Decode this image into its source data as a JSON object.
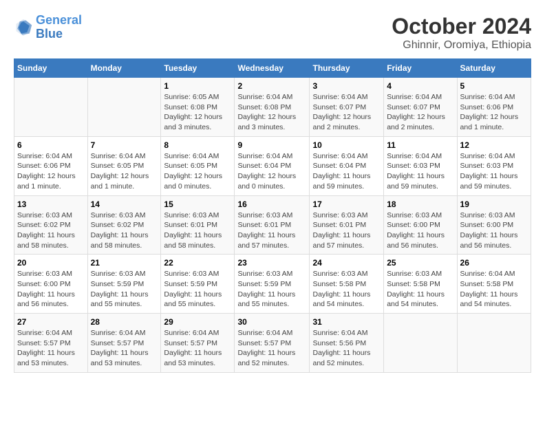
{
  "header": {
    "logo_line1": "General",
    "logo_line2": "Blue",
    "month": "October 2024",
    "location": "Ghinnir, Oromiya, Ethiopia"
  },
  "weekdays": [
    "Sunday",
    "Monday",
    "Tuesday",
    "Wednesday",
    "Thursday",
    "Friday",
    "Saturday"
  ],
  "weeks": [
    [
      {
        "day": "",
        "info": ""
      },
      {
        "day": "",
        "info": ""
      },
      {
        "day": "1",
        "info": "Sunrise: 6:05 AM\nSunset: 6:08 PM\nDaylight: 12 hours and 3 minutes."
      },
      {
        "day": "2",
        "info": "Sunrise: 6:04 AM\nSunset: 6:08 PM\nDaylight: 12 hours and 3 minutes."
      },
      {
        "day": "3",
        "info": "Sunrise: 6:04 AM\nSunset: 6:07 PM\nDaylight: 12 hours and 2 minutes."
      },
      {
        "day": "4",
        "info": "Sunrise: 6:04 AM\nSunset: 6:07 PM\nDaylight: 12 hours and 2 minutes."
      },
      {
        "day": "5",
        "info": "Sunrise: 6:04 AM\nSunset: 6:06 PM\nDaylight: 12 hours and 1 minute."
      }
    ],
    [
      {
        "day": "6",
        "info": "Sunrise: 6:04 AM\nSunset: 6:06 PM\nDaylight: 12 hours and 1 minute."
      },
      {
        "day": "7",
        "info": "Sunrise: 6:04 AM\nSunset: 6:05 PM\nDaylight: 12 hours and 1 minute."
      },
      {
        "day": "8",
        "info": "Sunrise: 6:04 AM\nSunset: 6:05 PM\nDaylight: 12 hours and 0 minutes."
      },
      {
        "day": "9",
        "info": "Sunrise: 6:04 AM\nSunset: 6:04 PM\nDaylight: 12 hours and 0 minutes."
      },
      {
        "day": "10",
        "info": "Sunrise: 6:04 AM\nSunset: 6:04 PM\nDaylight: 11 hours and 59 minutes."
      },
      {
        "day": "11",
        "info": "Sunrise: 6:04 AM\nSunset: 6:03 PM\nDaylight: 11 hours and 59 minutes."
      },
      {
        "day": "12",
        "info": "Sunrise: 6:04 AM\nSunset: 6:03 PM\nDaylight: 11 hours and 59 minutes."
      }
    ],
    [
      {
        "day": "13",
        "info": "Sunrise: 6:03 AM\nSunset: 6:02 PM\nDaylight: 11 hours and 58 minutes."
      },
      {
        "day": "14",
        "info": "Sunrise: 6:03 AM\nSunset: 6:02 PM\nDaylight: 11 hours and 58 minutes."
      },
      {
        "day": "15",
        "info": "Sunrise: 6:03 AM\nSunset: 6:01 PM\nDaylight: 11 hours and 58 minutes."
      },
      {
        "day": "16",
        "info": "Sunrise: 6:03 AM\nSunset: 6:01 PM\nDaylight: 11 hours and 57 minutes."
      },
      {
        "day": "17",
        "info": "Sunrise: 6:03 AM\nSunset: 6:01 PM\nDaylight: 11 hours and 57 minutes."
      },
      {
        "day": "18",
        "info": "Sunrise: 6:03 AM\nSunset: 6:00 PM\nDaylight: 11 hours and 56 minutes."
      },
      {
        "day": "19",
        "info": "Sunrise: 6:03 AM\nSunset: 6:00 PM\nDaylight: 11 hours and 56 minutes."
      }
    ],
    [
      {
        "day": "20",
        "info": "Sunrise: 6:03 AM\nSunset: 6:00 PM\nDaylight: 11 hours and 56 minutes."
      },
      {
        "day": "21",
        "info": "Sunrise: 6:03 AM\nSunset: 5:59 PM\nDaylight: 11 hours and 55 minutes."
      },
      {
        "day": "22",
        "info": "Sunrise: 6:03 AM\nSunset: 5:59 PM\nDaylight: 11 hours and 55 minutes."
      },
      {
        "day": "23",
        "info": "Sunrise: 6:03 AM\nSunset: 5:59 PM\nDaylight: 11 hours and 55 minutes."
      },
      {
        "day": "24",
        "info": "Sunrise: 6:03 AM\nSunset: 5:58 PM\nDaylight: 11 hours and 54 minutes."
      },
      {
        "day": "25",
        "info": "Sunrise: 6:03 AM\nSunset: 5:58 PM\nDaylight: 11 hours and 54 minutes."
      },
      {
        "day": "26",
        "info": "Sunrise: 6:04 AM\nSunset: 5:58 PM\nDaylight: 11 hours and 54 minutes."
      }
    ],
    [
      {
        "day": "27",
        "info": "Sunrise: 6:04 AM\nSunset: 5:57 PM\nDaylight: 11 hours and 53 minutes."
      },
      {
        "day": "28",
        "info": "Sunrise: 6:04 AM\nSunset: 5:57 PM\nDaylight: 11 hours and 53 minutes."
      },
      {
        "day": "29",
        "info": "Sunrise: 6:04 AM\nSunset: 5:57 PM\nDaylight: 11 hours and 53 minutes."
      },
      {
        "day": "30",
        "info": "Sunrise: 6:04 AM\nSunset: 5:57 PM\nDaylight: 11 hours and 52 minutes."
      },
      {
        "day": "31",
        "info": "Sunrise: 6:04 AM\nSunset: 5:56 PM\nDaylight: 11 hours and 52 minutes."
      },
      {
        "day": "",
        "info": ""
      },
      {
        "day": "",
        "info": ""
      }
    ]
  ]
}
